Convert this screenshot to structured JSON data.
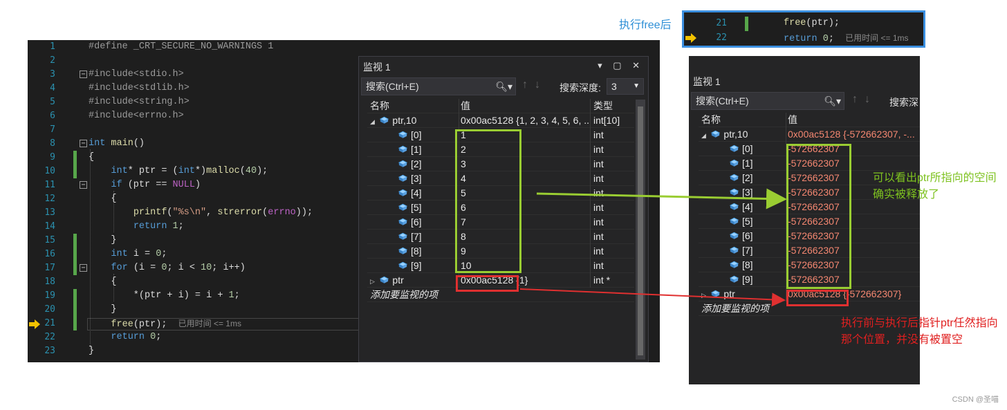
{
  "editor": {
    "lines": [
      {
        "n": "1"
      },
      {
        "n": "2"
      },
      {
        "n": "3"
      },
      {
        "n": "4"
      },
      {
        "n": "5"
      },
      {
        "n": "6"
      },
      {
        "n": "7"
      },
      {
        "n": "8"
      },
      {
        "n": "9"
      },
      {
        "n": "10"
      },
      {
        "n": "11"
      },
      {
        "n": "12"
      },
      {
        "n": "13"
      },
      {
        "n": "14"
      },
      {
        "n": "15"
      },
      {
        "n": "16"
      },
      {
        "n": "17"
      },
      {
        "n": "18"
      },
      {
        "n": "19"
      },
      {
        "n": "20"
      },
      {
        "n": "21"
      },
      {
        "n": "22"
      },
      {
        "n": "23"
      }
    ],
    "define": "#define _CRT_SECURE_NO_WARNINGS 1",
    "inc1": "#include<stdio.h>",
    "inc2": "#include<stdlib.h>",
    "inc3": "#include<string.h>",
    "inc4": "#include<errno.h>",
    "hint_time": "已用时间 <= 1ms"
  },
  "watch_left": {
    "title": "监视 1",
    "search_placeholder": "搜索(Ctrl+E)",
    "depth_label": "搜索深度:",
    "depth_value": "3",
    "col_name": "名称",
    "col_value": "值",
    "col_type": "类型",
    "rows": [
      {
        "name": "ptr,10",
        "value": "0x00ac5128 {1, 2, 3, 4, 5, 6, ...",
        "type": "int[10]"
      },
      {
        "name": "[0]",
        "value": "1",
        "type": "int"
      },
      {
        "name": "[1]",
        "value": "2",
        "type": "int"
      },
      {
        "name": "[2]",
        "value": "3",
        "type": "int"
      },
      {
        "name": "[3]",
        "value": "4",
        "type": "int"
      },
      {
        "name": "[4]",
        "value": "5",
        "type": "int"
      },
      {
        "name": "[5]",
        "value": "6",
        "type": "int"
      },
      {
        "name": "[6]",
        "value": "7",
        "type": "int"
      },
      {
        "name": "[7]",
        "value": "8",
        "type": "int"
      },
      {
        "name": "[8]",
        "value": "9",
        "type": "int"
      },
      {
        "name": "[9]",
        "value": "10",
        "type": "int"
      },
      {
        "name": "ptr",
        "value": "0x00ac5128 {1}",
        "type": "int *"
      }
    ],
    "add_item": "添加要监视的项"
  },
  "snippet": {
    "label": "执行free后",
    "line1_n": "21",
    "line2_n": "22"
  },
  "watch_right": {
    "title": "监视 1",
    "search_placeholder": "搜索(Ctrl+E)",
    "depth_label": "搜索深",
    "col_name": "名称",
    "col_value": "值",
    "rows": [
      {
        "name": "ptr,10",
        "value": "0x00ac5128 {-572662307, -..."
      },
      {
        "name": "[0]",
        "value": "-572662307"
      },
      {
        "name": "[1]",
        "value": "-572662307"
      },
      {
        "name": "[2]",
        "value": "-572662307"
      },
      {
        "name": "[3]",
        "value": "-572662307"
      },
      {
        "name": "[4]",
        "value": "-572662307"
      },
      {
        "name": "[5]",
        "value": "-572662307"
      },
      {
        "name": "[6]",
        "value": "-572662307"
      },
      {
        "name": "[7]",
        "value": "-572662307"
      },
      {
        "name": "[8]",
        "value": "-572662307"
      },
      {
        "name": "[9]",
        "value": "-572662307"
      },
      {
        "name": "ptr",
        "value": "0x00ac5128 {-572662307}"
      }
    ],
    "add_item": "添加要监视的项"
  },
  "annotations": {
    "green_note": "可以看出ptr所指向的空间确实被释放了",
    "red_note": "执行前与执行后指针ptr任然指向那个位置，并没有被置空",
    "credit": "CSDN @圣喵"
  },
  "colors": {
    "green": "#9acd32",
    "red": "#e03030",
    "blue": "#3b8fe0"
  }
}
